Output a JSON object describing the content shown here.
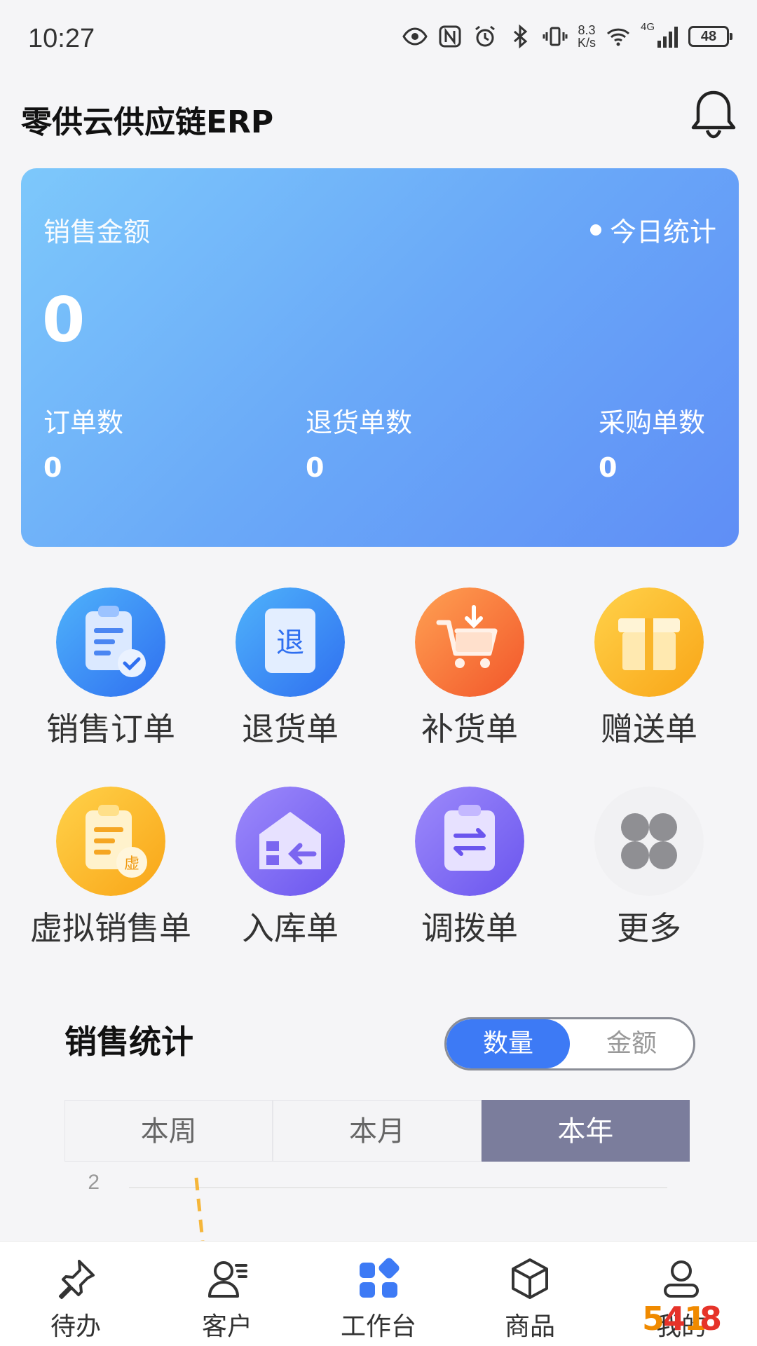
{
  "status_bar": {
    "time": "10:27",
    "net_speed_value": "8.3",
    "net_speed_unit": "K/s",
    "signal_label": "4G",
    "battery": "48"
  },
  "header": {
    "title": "零供云供应链ERP"
  },
  "sales_card": {
    "label": "销售金额",
    "period": "今日统计",
    "amount": "0",
    "metrics": [
      {
        "label": "订单数",
        "value": "0"
      },
      {
        "label": "退货单数",
        "value": "0"
      },
      {
        "label": "采购单数",
        "value": "0"
      }
    ]
  },
  "actions": [
    {
      "label": "销售订单",
      "icon": "sales-order-icon"
    },
    {
      "label": "退货单",
      "icon": "return-icon",
      "glyph": "退"
    },
    {
      "label": "补货单",
      "icon": "restock-cart-icon"
    },
    {
      "label": "赠送单",
      "icon": "gift-icon"
    },
    {
      "label": "虚拟销售单",
      "icon": "virtual-sales-icon",
      "glyph": "虚"
    },
    {
      "label": "入库单",
      "icon": "warehouse-in-icon"
    },
    {
      "label": "调拨单",
      "icon": "transfer-icon"
    },
    {
      "label": "更多",
      "icon": "more-grid-icon"
    }
  ],
  "sales_stats": {
    "title": "销售统计",
    "toggle": [
      "数量",
      "金额"
    ],
    "toggle_selected": "数量",
    "periods": [
      "本周",
      "本月",
      "本年"
    ],
    "period_selected": "本年",
    "y_tick": "2"
  },
  "bottom_nav": [
    {
      "label": "待办",
      "icon": "pin-icon"
    },
    {
      "label": "客户",
      "icon": "customer-icon"
    },
    {
      "label": "工作台",
      "icon": "workbench-icon",
      "active": true
    },
    {
      "label": "商品",
      "icon": "box-icon"
    },
    {
      "label": "我的",
      "icon": "profile-icon"
    }
  ],
  "colors": {
    "accent": "#3d7af5",
    "card_gradient_start": "#7dc8fb",
    "card_gradient_end": "#5f8ef6",
    "period_active": "#7b7d9c",
    "chart_line": "#f5b63a"
  }
}
